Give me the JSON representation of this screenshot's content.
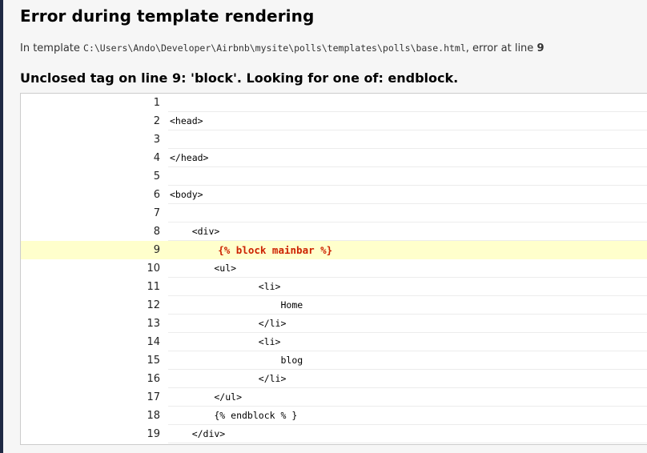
{
  "page": {
    "title": "Error during template rendering",
    "template_prefix": "In template ",
    "template_path": "C:\\Users\\Ando\\Developer\\Airbnb\\mysite\\polls\\templates\\polls\\base.html",
    "template_mid": ", error at line ",
    "error_line": "9",
    "error_message": "Unclosed tag on line 9: 'block'. Looking for one of: endblock."
  },
  "source": {
    "current_line": 9,
    "lines": [
      {
        "num": "1",
        "code": ""
      },
      {
        "num": "2",
        "code": "<head>"
      },
      {
        "num": "3",
        "code": ""
      },
      {
        "num": "4",
        "code": "</head>"
      },
      {
        "num": "5",
        "code": ""
      },
      {
        "num": "6",
        "code": "<body>"
      },
      {
        "num": "7",
        "code": ""
      },
      {
        "num": "8",
        "code": "    <div>"
      },
      {
        "num": "9",
        "code": "        {% block mainbar %}"
      },
      {
        "num": "10",
        "code": "        <ul>"
      },
      {
        "num": "11",
        "code": "                <li>"
      },
      {
        "num": "12",
        "code": "                    Home"
      },
      {
        "num": "13",
        "code": "                </li>"
      },
      {
        "num": "14",
        "code": "                <li>"
      },
      {
        "num": "15",
        "code": "                    blog"
      },
      {
        "num": "16",
        "code": "                </li>"
      },
      {
        "num": "17",
        "code": "        </ul>"
      },
      {
        "num": "18",
        "code": "        {% endblock % }"
      },
      {
        "num": "19",
        "code": "    </div>"
      }
    ]
  },
  "colors": {
    "highlight_bg": "#ffffcc",
    "highlight_text": "#cc2200"
  }
}
